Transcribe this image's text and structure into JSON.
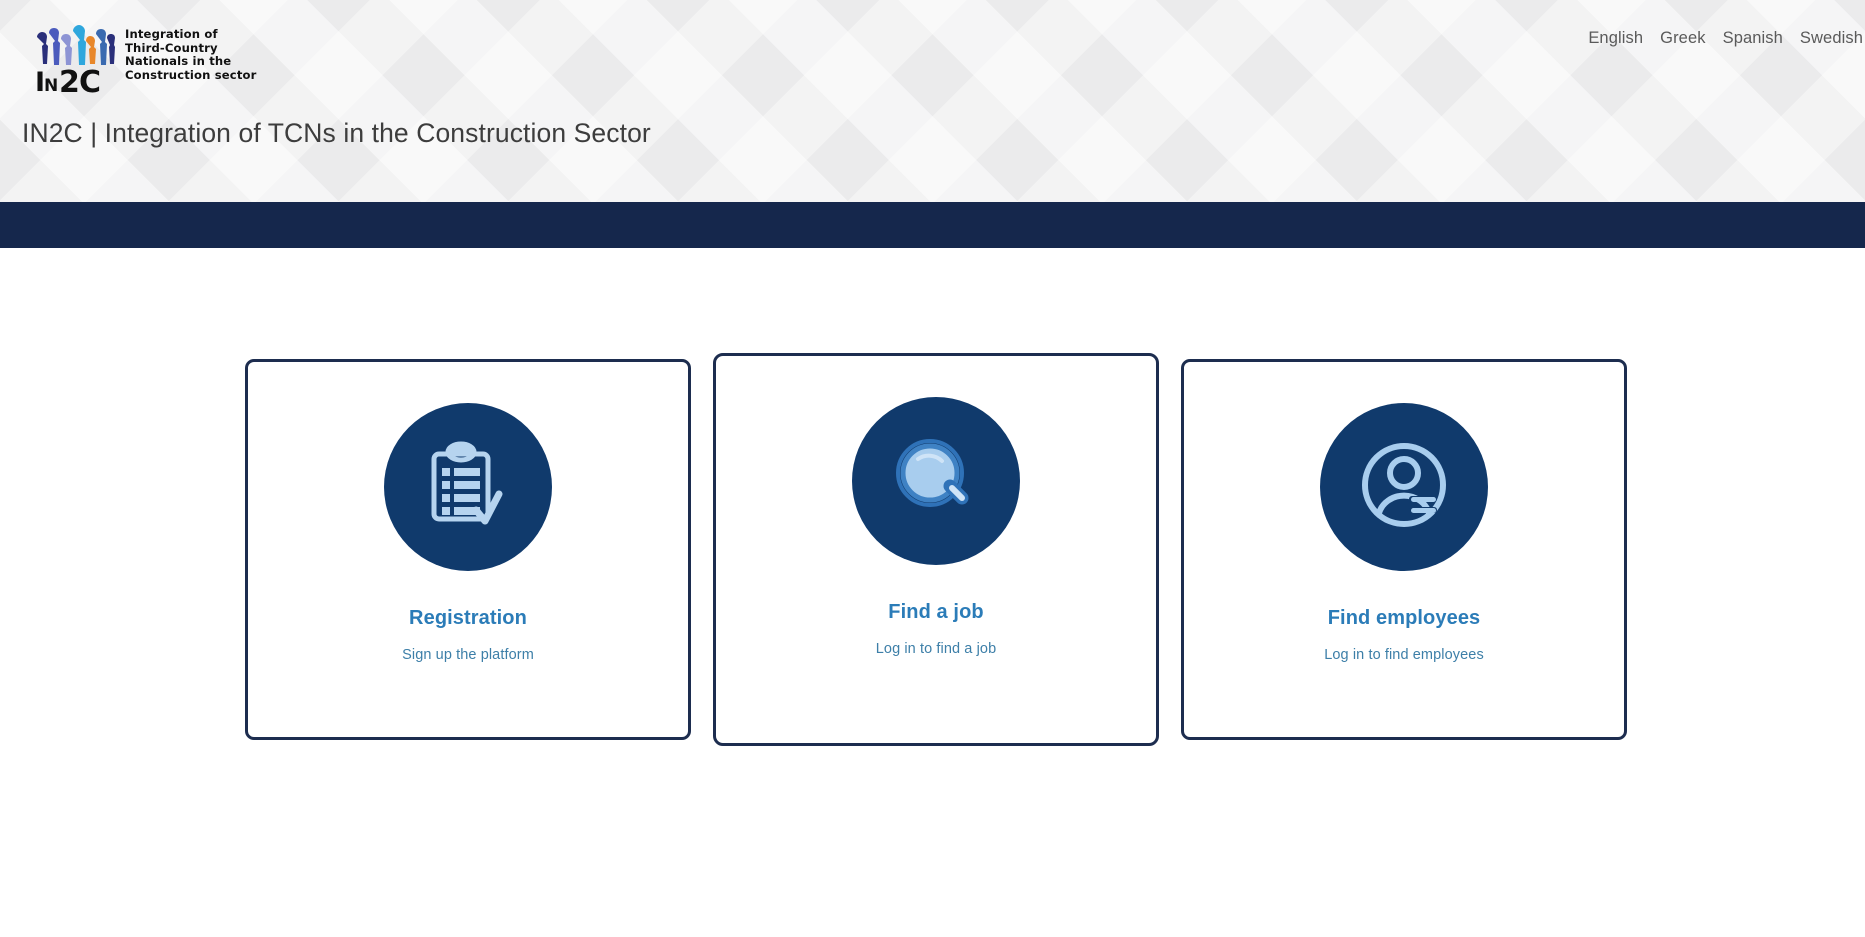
{
  "header": {
    "logo": {
      "wordmark": "IN2C",
      "tagline_lines": [
        "Integration of",
        "Third-Country",
        "Nationals in the",
        "Construction sector"
      ],
      "alt": "IN2C logo"
    },
    "site_title": "IN2C | Integration of TCNs in the Construction Sector",
    "languages": [
      {
        "label": "English"
      },
      {
        "label": "Greek"
      },
      {
        "label": "Spanish"
      },
      {
        "label": "Swedish"
      }
    ]
  },
  "navbar": {
    "items": []
  },
  "main": {
    "cards": [
      {
        "icon": "clipboard-checklist-icon",
        "title": "Registration",
        "subtitle": "Sign up the platform",
        "raised": false
      },
      {
        "icon": "magnifying-glass-icon",
        "title": "Find a job",
        "subtitle": "Log in to find a job",
        "raised": true
      },
      {
        "icon": "user-profile-icon",
        "title": "Find employees",
        "subtitle": "Log in to find employees",
        "raised": false
      }
    ]
  },
  "colors": {
    "navy_bar": "#15274c",
    "card_border": "#1d2d4f",
    "icon_circle": "#103a6c",
    "icon_light": "#b6d4ef",
    "title_blue": "#2b7cb8",
    "subtitle_blue": "#3d7fa8",
    "header_bg": "#ebebec"
  }
}
